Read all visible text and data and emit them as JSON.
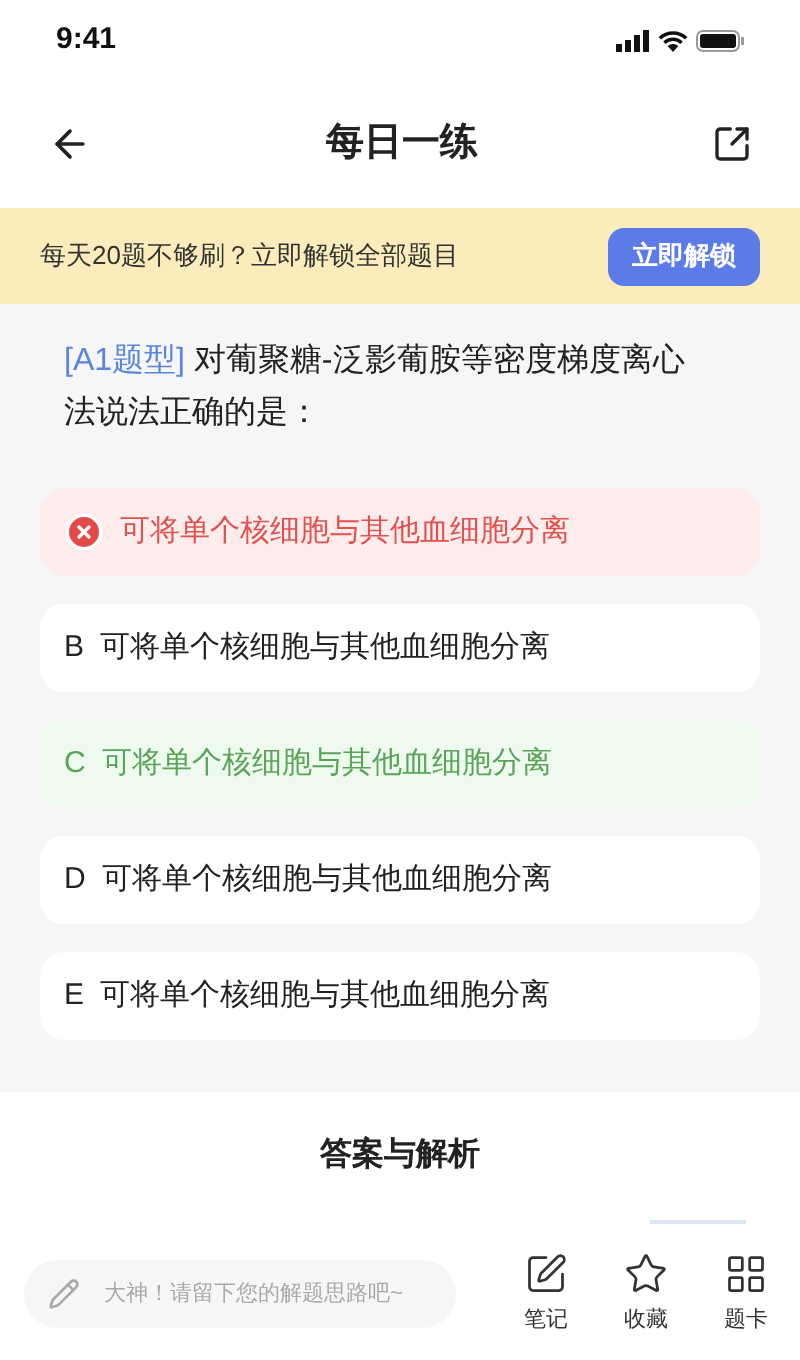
{
  "status_bar": {
    "time": "9:41"
  },
  "header": {
    "title": "每日一练"
  },
  "banner": {
    "text": "每天20题不够刷？立即解锁全部题目",
    "button": "立即解锁"
  },
  "question": {
    "tag": "[A1题型]",
    "text": "对葡聚糖-泛影葡胺等密度梯度离心法说法正确的是："
  },
  "options": [
    {
      "kind": "wrong",
      "text": "可将单个核细胞与其他血细胞分离"
    },
    {
      "kind": "plain",
      "letter": "B",
      "text": "可将单个核细胞与其他血细胞分离"
    },
    {
      "kind": "correct",
      "letter": "C",
      "text": "可将单个核细胞与其他血细胞分离"
    },
    {
      "kind": "plain",
      "letter": "D",
      "text": "可将单个核细胞与其他血细胞分离"
    },
    {
      "kind": "plain",
      "letter": "E",
      "text": "可将单个核细胞与其他血细胞分离"
    }
  ],
  "analysis": {
    "title": "答案与解析"
  },
  "bottom_bar": {
    "placeholder": "大神！请留下您的解题思路吧~",
    "actions": [
      {
        "kind": "note",
        "label": "笔记"
      },
      {
        "kind": "star",
        "label": "收藏"
      },
      {
        "kind": "grid",
        "label": "题卡"
      }
    ]
  }
}
